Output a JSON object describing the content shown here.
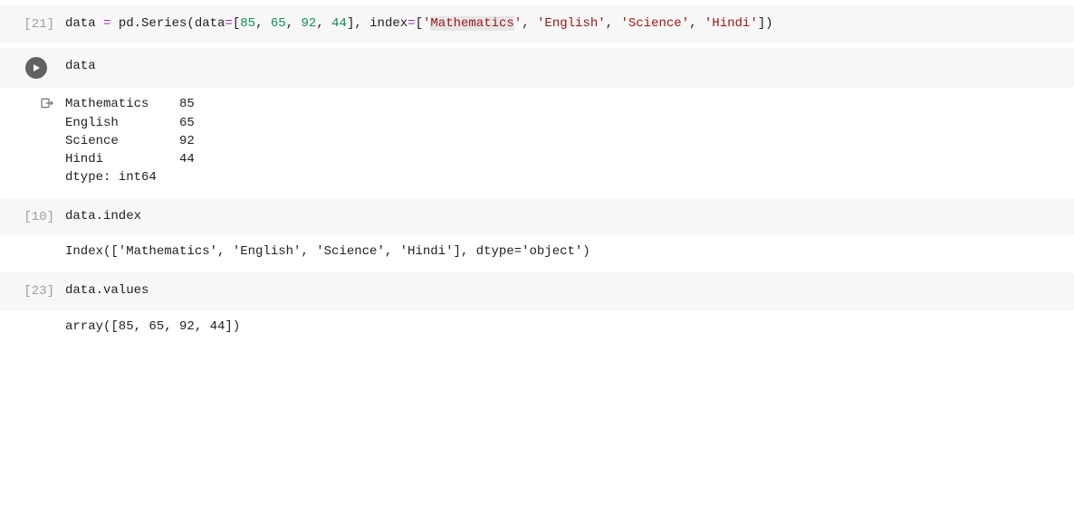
{
  "cells": [
    {
      "prompt": "[21]",
      "code": {
        "pre": "data ",
        "eq": "=",
        "post_eq": " pd.Series(data",
        "eq2": "=",
        "open": "[",
        "nums": [
          "85",
          "65",
          "92",
          "44"
        ],
        "close_data": "], index",
        "eq3": "=",
        "open2": "[",
        "strs": [
          "'Mathematics'",
          "'English'",
          "'Science'",
          "'Hindi'"
        ],
        "close": "])"
      }
    },
    {
      "run_button": true,
      "code_plain": "data",
      "output_lines": [
        "Mathematics    85",
        "English        65",
        "Science        92",
        "Hindi          44",
        "dtype: int64"
      ]
    },
    {
      "prompt": "[10]",
      "code_plain": "data.index",
      "output_plain": "Index(['Mathematics', 'English', 'Science', 'Hindi'], dtype='object')"
    },
    {
      "prompt": "[23]",
      "code_plain": "data.values",
      "output_plain": "array([85, 65, 92, 44])"
    }
  ]
}
